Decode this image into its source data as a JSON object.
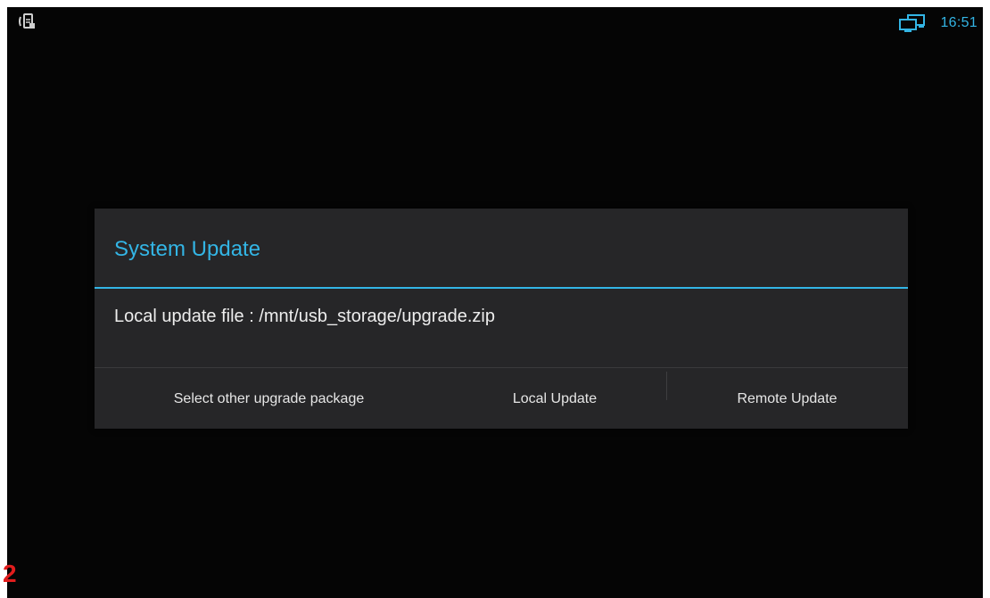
{
  "status_bar": {
    "time": "16:51",
    "left_icon": "notification-phone-icon",
    "network_icon": "ethernet-network-icon"
  },
  "dialog": {
    "title": "System Update",
    "message": "Local update file : /mnt/usb_storage/upgrade.zip",
    "buttons": [
      {
        "label": "Select other upgrade package"
      },
      {
        "label": "Local Update"
      },
      {
        "label": "Remote Update"
      }
    ]
  },
  "corner_mark": "2",
  "colors": {
    "accent": "#33b5e5",
    "background": "#050505",
    "dialog_bg": "#262628",
    "corner_mark": "#e21d1d"
  }
}
